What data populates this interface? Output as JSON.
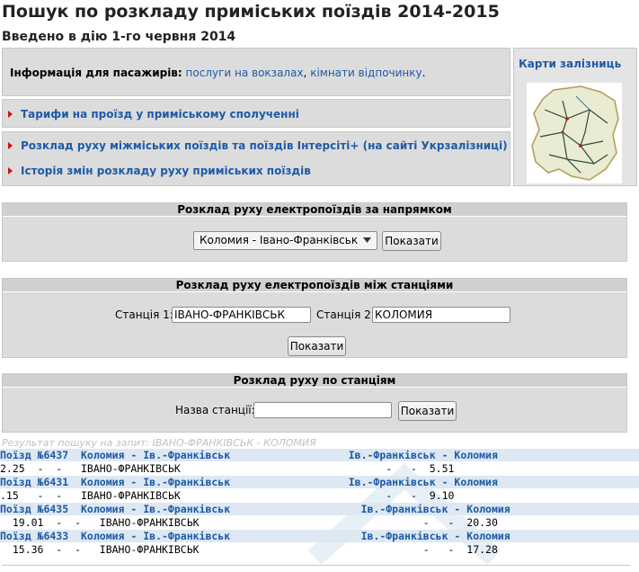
{
  "header": {
    "title": "Пошук по розкладу приміських поїздів 2014-2015",
    "subtitle": "Введено в дію 1-го червня 2014"
  },
  "info": {
    "label": "Інформація для пасажирів:",
    "link1": "послуги на вокзалах",
    "sep": ",",
    "link2": "кімнати відпочинку",
    "end": "."
  },
  "links": {
    "tariffs": "Тарифи на проїзд у приміському сполученні",
    "intercity": "Розклад руху міжміських поїздів та поїздів Інтерсіті+ (на сайті Укрзалізниці)",
    "history": "Історія змін розкладу руху приміських поїздів"
  },
  "maps": {
    "label": "Карти залізниць"
  },
  "direction": {
    "heading": "Розклад руху електропоїздів за напрямком",
    "selected": "Коломия - Івано-Франківськ",
    "button": "Показати"
  },
  "between": {
    "heading": "Розклад руху електропоїздів між станціями",
    "station1_label": "Станція 1:",
    "station1_value": "ІВАНО-ФРАНКІВСЬК",
    "station2_label": "Станція 2:",
    "station2_value": "КОЛОМИЯ",
    "button": "Показати"
  },
  "bystation": {
    "heading": "Розклад руху по станціям",
    "label": "Назва станції:",
    "value": "",
    "button": "Показати"
  },
  "results": {
    "caption": "Результат пошуку на запит: ІВАНО-ФРАНКІВСЬК - КОЛОМИЯ",
    "trains": [
      {
        "header": "Поїзд №6437  Коломия - Ів.-Франківськ                   Ів.-Франківськ - Коломия",
        "detail": "2.25  -  -   ІВАНО-ФРАНКІВСЬК                                 -   -  5.51"
      },
      {
        "header": "Поїзд №6431  Коломия - Ів.-Франківськ                   Ів.-Франківськ - Коломия",
        "detail": ".15   -  -   ІВАНО-ФРАНКІВСЬК                                 -   -  9.10"
      },
      {
        "header": "Поїзд №6435  Коломия - Ів.-Франківськ                     Ів.-Франківськ - Коломия",
        "detail": "  19.01  -  -   ІВАНО-ФРАНКІВСЬК                                    -   -  20.30"
      },
      {
        "header": "Поїзд №6433  Коломия - Ів.-Франківськ                     Ів.-Франківськ - Коломия",
        "detail": "  15.36  -  -   ІВАНО-ФРАНКІВСЬК                                    -   -  17.28"
      }
    ]
  }
}
